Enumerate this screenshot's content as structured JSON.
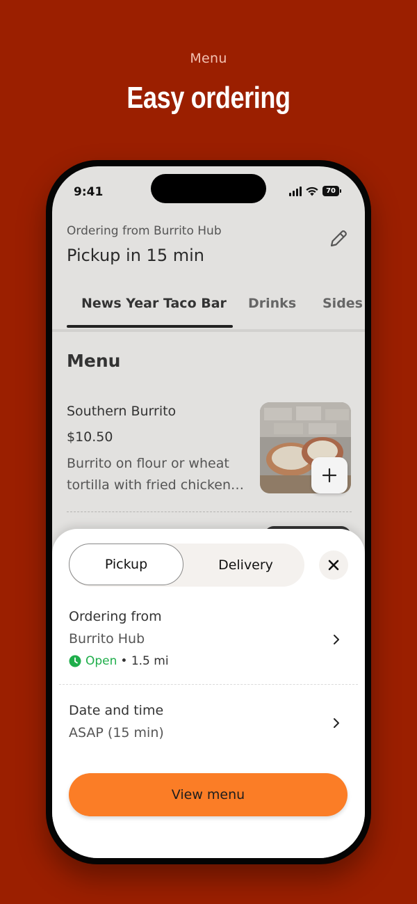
{
  "marketing": {
    "eyebrow": "Menu",
    "headline": "Easy ordering"
  },
  "status_bar": {
    "time": "9:41",
    "battery": "70"
  },
  "header": {
    "ordering_from": "Ordering from Burrito Hub",
    "pickup_title": "Pickup in 15 min",
    "edit_icon": "pencil-icon"
  },
  "tabs": [
    {
      "label": "News Year Taco Bar",
      "active": true
    },
    {
      "label": "Drinks",
      "active": false
    },
    {
      "label": "Sides",
      "active": false
    }
  ],
  "menu": {
    "heading": "Menu",
    "items": [
      {
        "name": "Southern Burrito",
        "price": "$10.50",
        "description": "Burrito on flour or wheat tortilla with fried chicken…",
        "add_icon": "plus-icon"
      }
    ]
  },
  "sheet": {
    "mode_options": [
      "Pickup",
      "Delivery"
    ],
    "selected_mode": "Pickup",
    "close_icon": "close-icon",
    "ordering_row": {
      "title": "Ordering from",
      "store": "Burrito Hub",
      "status": "Open",
      "distance": "• 1.5 mi"
    },
    "datetime_row": {
      "title": "Date and time",
      "value": "ASAP (15 min)"
    },
    "cta": "View menu"
  },
  "colors": {
    "background": "#9b1f00",
    "accent": "#fb7d26",
    "open_green": "#1fae4b"
  }
}
